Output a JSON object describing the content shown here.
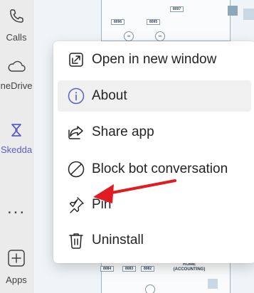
{
  "rail": {
    "items": [
      {
        "label": "Calls",
        "icon": "phone-icon"
      },
      {
        "label": "OneDrive",
        "icon": "cloud-icon"
      },
      {
        "label": "Skedda",
        "icon": "skedda-icon",
        "active": true
      },
      {
        "label": "...",
        "icon": "more-icon"
      },
      {
        "label": "Apps",
        "icon": "apps-icon"
      }
    ]
  },
  "floorplan": {
    "tags": [
      "8097",
      "8096",
      "8095",
      "8084",
      "8083",
      "8082"
    ],
    "circles": [
      "35",
      "5H"
    ],
    "room_label_1": "ROME",
    "room_label_2": "(ACCOUNTING)"
  },
  "menu": {
    "items": [
      {
        "label": "Open in new window",
        "icon": "open-in-new-window-icon"
      },
      {
        "label": "About",
        "icon": "info-icon",
        "hovered": true
      },
      {
        "label": "Share app",
        "icon": "share-icon"
      },
      {
        "label": "Block bot conversation",
        "icon": "block-icon"
      },
      {
        "label": "Pin",
        "icon": "pin-icon"
      },
      {
        "label": "Uninstall",
        "icon": "trash-icon"
      }
    ]
  },
  "colors": {
    "accent": "#5b5fc7",
    "annotation_arrow": "#e11b22",
    "hover_bg": "#f0f0f0"
  }
}
